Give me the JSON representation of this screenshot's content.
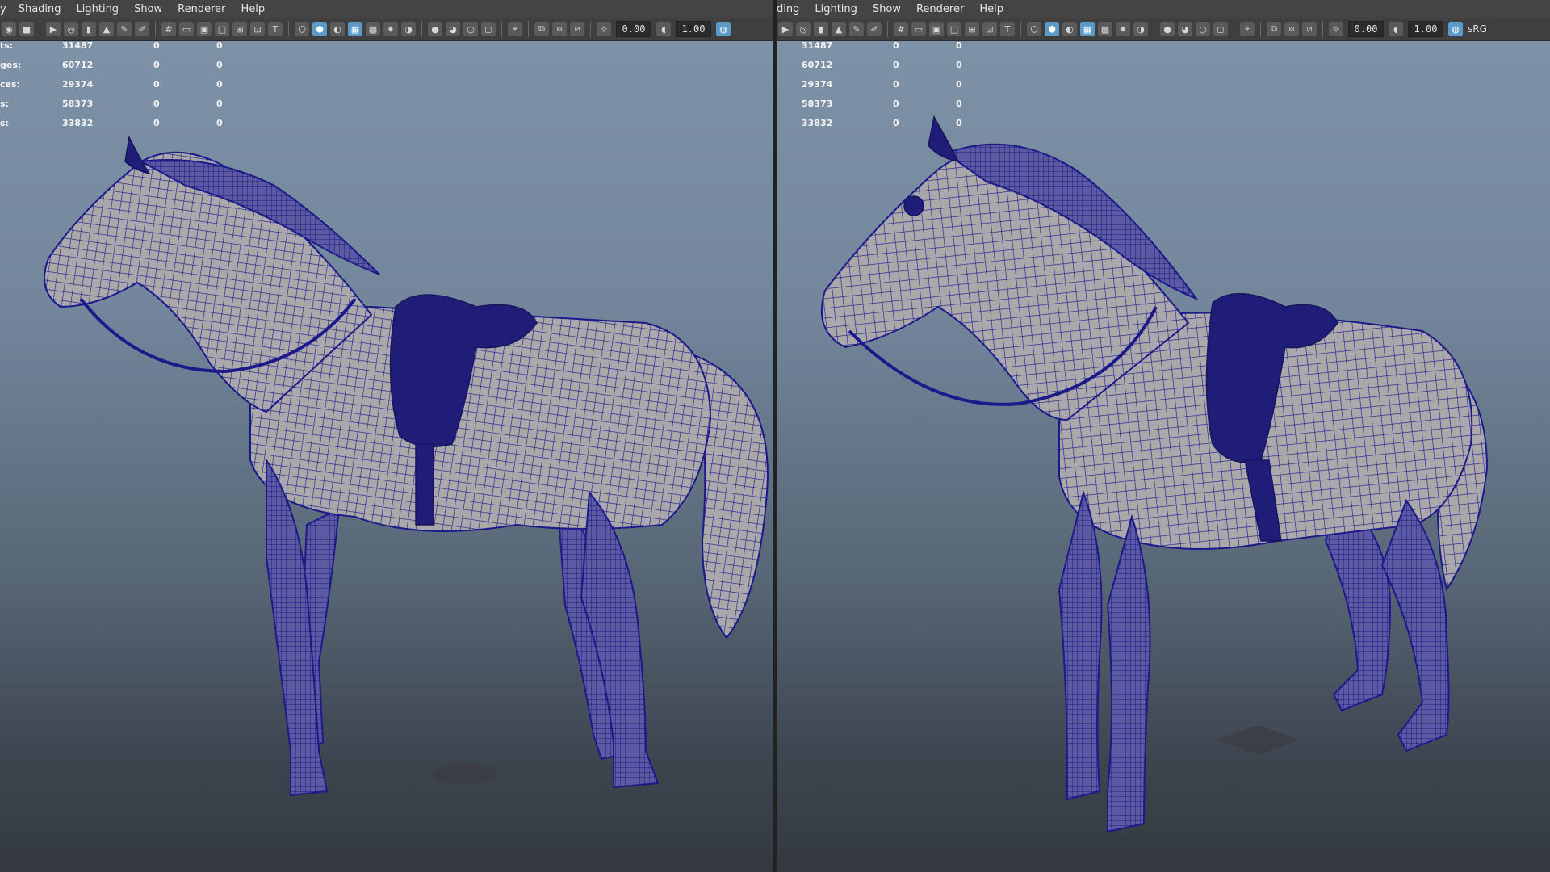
{
  "menus": {
    "left": [
      "y",
      "Shading",
      "Lighting",
      "Show",
      "Renderer",
      "Help"
    ],
    "right": [
      "ding",
      "Lighting",
      "Show",
      "Renderer",
      "Help"
    ]
  },
  "toolbar": {
    "field_a": "0.00",
    "field_b": "1.00",
    "color_space": "sRG"
  },
  "hud": {
    "left_labels": [
      "ts:",
      "ges:",
      "ces:",
      "s:",
      "s:"
    ],
    "values": [
      "31487",
      "60712",
      "29374",
      "58373",
      "33832"
    ],
    "zero": "0"
  },
  "colors": {
    "wire": "#1c1a8a",
    "mesh_fill": "#a8a6a8",
    "viewport_top": "#7f93a9",
    "viewport_bottom": "#34393f"
  },
  "icons": [
    "camera-icon",
    "grid-icon",
    "wireframe-icon",
    "shaded-icon",
    "textured-icon",
    "light-icon",
    "shadow-icon",
    "isolate-icon",
    "xray-icon",
    "exposure-icon",
    "gamma-icon",
    "colorspace-icon"
  ]
}
